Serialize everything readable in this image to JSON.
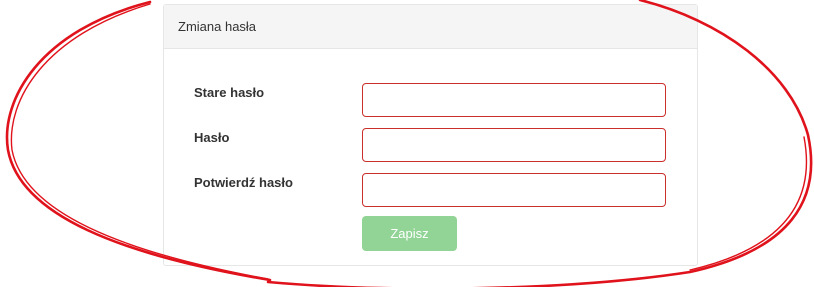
{
  "panel": {
    "title": "Zmiana hasła"
  },
  "form": {
    "fields": [
      {
        "label": "Stare hasło",
        "value": ""
      },
      {
        "label": "Hasło",
        "value": ""
      },
      {
        "label": "Potwierdź hasło",
        "value": ""
      }
    ],
    "submit_label": "Zapisz"
  },
  "colors": {
    "error_border": "#c9302c",
    "submit_bg": "#91d496",
    "annotation_stroke": "#e0121b"
  }
}
